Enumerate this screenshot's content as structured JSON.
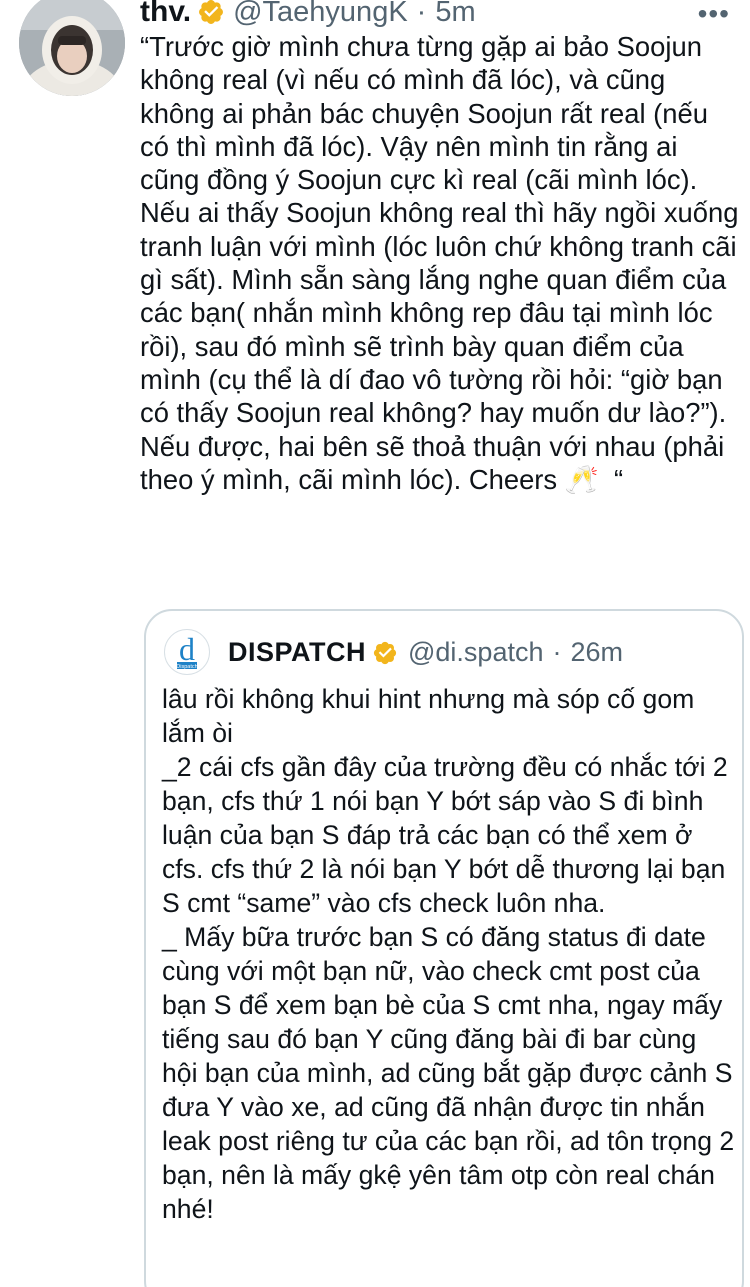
{
  "tweet": {
    "author": {
      "display_name": "thv.",
      "handle": "@TaehyungK",
      "verified": true
    },
    "timestamp": "5m",
    "separator": "·",
    "more_label": "•••",
    "text": "“Trước giờ mình chưa từng gặp ai bảo Soojun không real (vì nếu có mình đã lóc), và cũng không ai phản bác chuyện Soojun rất real (nếu có thì mình đã lóc). Vậy nên mình tin rằng ai cũng đồng ý Soojun cực kì real (cãi mình lóc). Nếu ai thấy Soojun không real thì hãy ngồi xuống tranh luận với mình (lóc luôn chứ không tranh cãi gì sất). Mình sẵn sàng lắng nghe quan điểm của các bạn( nhắn mình không rep đâu tại mình lóc rồi), sau đó mình sẽ trình bày quan điểm của mình (cụ thể là dí đao vô tường rồi hỏi: “giờ bạn có thấy Soojun real không? hay muốn dư lào?”). Nếu được, hai bên sẽ thoả thuận với nhau (phải theo ý mình, cãi mình lóc). Cheers 🥂  “"
  },
  "quoted_tweet": {
    "author": {
      "display_name": "DISPATCH",
      "handle": "@di.spatch",
      "verified": true,
      "avatar_letter": "d",
      "avatar_caption": "Dispatch"
    },
    "timestamp": "26m",
    "separator": "·",
    "text": "lâu rồi không khui hint nhưng mà sóp cố gom lắm òi\n_2 cái cfs gần đây của trường đều có nhắc tới 2 bạn, cfs thứ 1 nói bạn Y bớt sáp vào S đi bình luận của bạn S đáp trả các bạn có thể xem ở cfs. cfs thứ 2 là nói bạn Y bớt dễ thương lại bạn S cmt “same” vào cfs check luôn nha.\n_ Mấy bữa trước bạn S có đăng status đi date cùng với một bạn nữ, vào check cmt post của bạn S để xem bạn bè của S cmt nha, ngay mấy tiếng sau đó bạn Y cũng đăng bài đi bar cùng hội bạn của mình, ad cũng bắt gặp được cảnh S đưa Y vào xe, ad cũng đã nhận được tin nhắn leak post riêng tư của các bạn rồi, ad tôn trọng 2 bạn, nên là mấy gkệ yên tâm otp còn real chán nhé!"
  },
  "icons": {
    "verified_badge": "verified-badge-icon",
    "more": "more-options-icon"
  },
  "colors": {
    "text_primary": "#0f1419",
    "text_secondary": "#536471",
    "verified_badge": "#f2b51c",
    "card_border": "#cfd9de",
    "dispatch_blue": "#1e82c7"
  }
}
